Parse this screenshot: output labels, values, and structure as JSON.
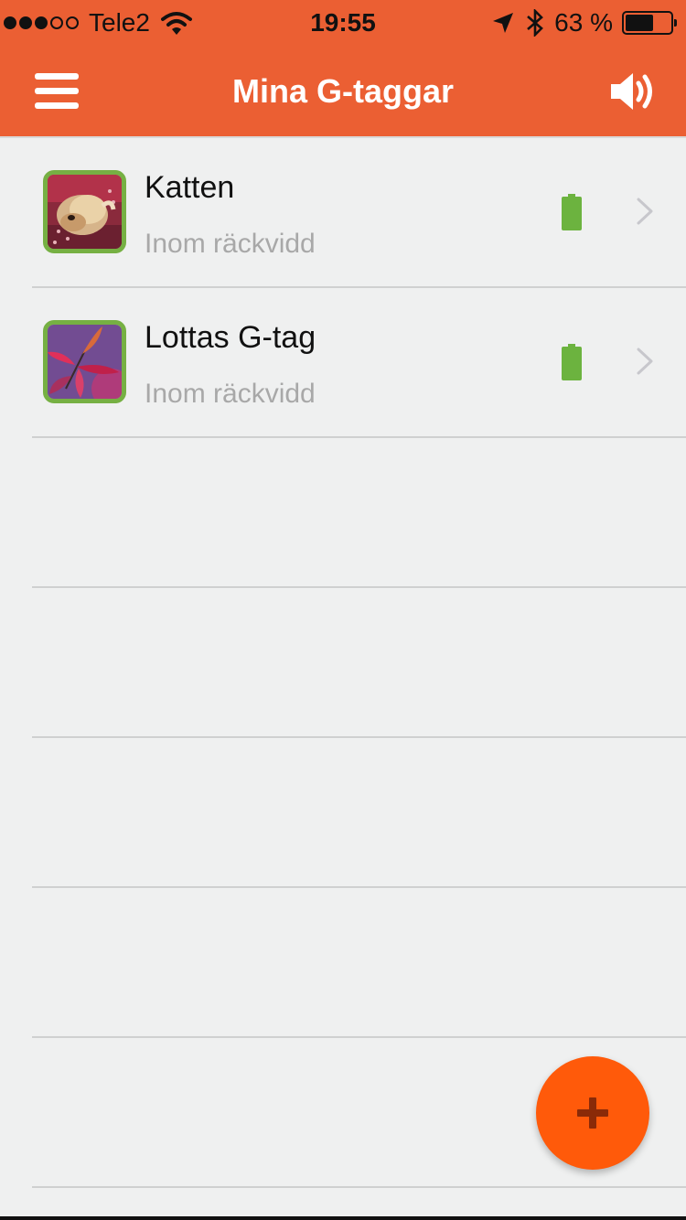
{
  "status_bar": {
    "carrier": "Tele2",
    "time": "19:55",
    "battery_percent": "63 %",
    "battery_level": 0.63,
    "signal_bars_filled": 3,
    "signal_bars_total": 5,
    "icons": [
      "wifi-icon",
      "location-arrow-icon",
      "bluetooth-icon",
      "battery-icon"
    ]
  },
  "header": {
    "title": "Mina G-taggar",
    "menu_icon": "hamburger-menu-icon",
    "sound_icon": "speaker-icon",
    "background_color": "#eb5f33"
  },
  "tags": [
    {
      "name": "Katten",
      "status": "Inom räckvidd",
      "photo": "cat-photo",
      "battery_icon": "battery-full-icon",
      "battery_color": "#6cb33f"
    },
    {
      "name": "Lottas G-tag",
      "status": "Inom räckvidd",
      "photo": "red-leaves-photo",
      "battery_icon": "battery-full-icon",
      "battery_color": "#6cb33f"
    }
  ],
  "fab": {
    "icon": "plus-icon",
    "color": "#ff5a0a"
  }
}
